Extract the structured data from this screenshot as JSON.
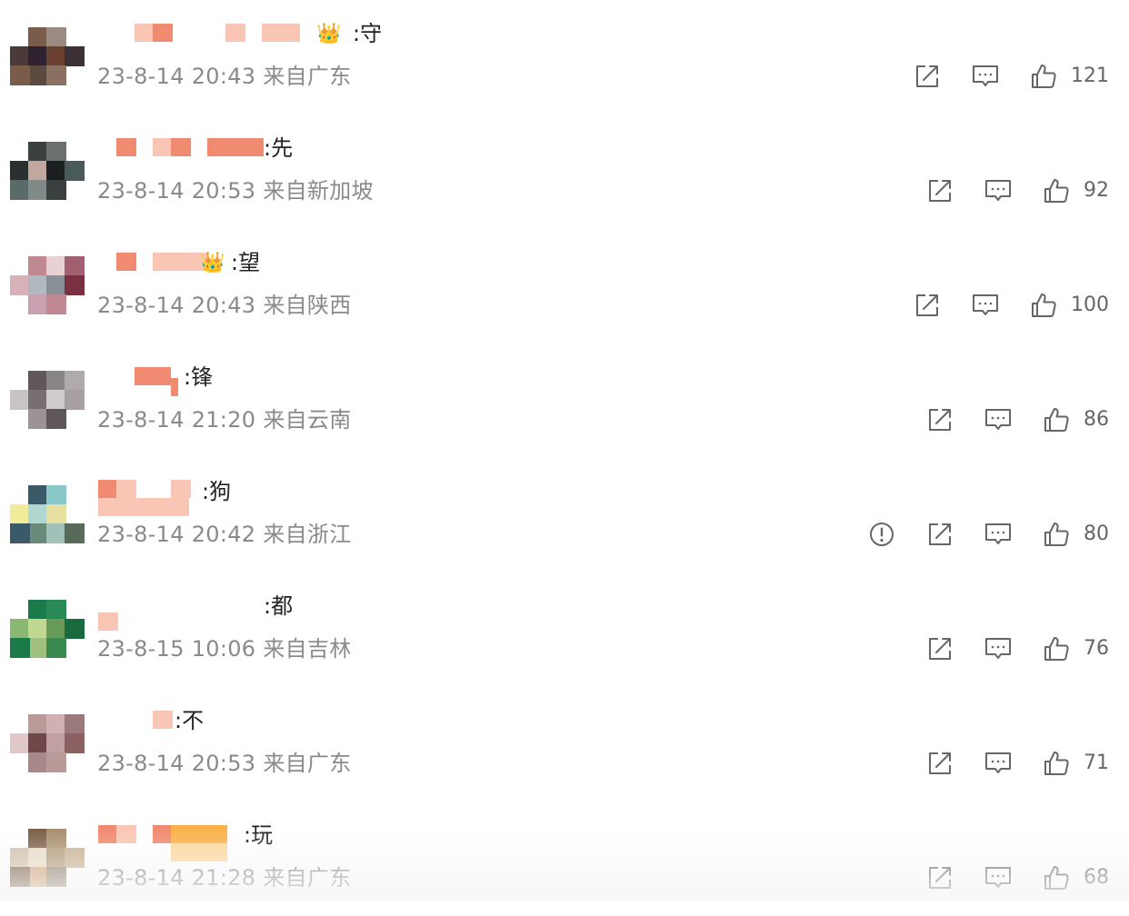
{
  "comments": [
    {
      "text": ":守",
      "timestamp": "23-8-14 20:43",
      "location_prefix": "来自",
      "location": "广东",
      "likes": "121",
      "crown": true,
      "report": false
    },
    {
      "text": ":先",
      "timestamp": "23-8-14 20:53",
      "location_prefix": "来自",
      "location": "新加坡",
      "likes": "92",
      "crown": false,
      "report": false
    },
    {
      "text": ":望",
      "timestamp": "23-8-14 20:43",
      "location_prefix": "来自",
      "location": "陕西",
      "likes": "100",
      "crown": true,
      "report": false
    },
    {
      "text": ":锋",
      "timestamp": "23-8-14 21:20",
      "location_prefix": "来自",
      "location": "云南",
      "likes": "86",
      "crown": false,
      "report": false
    },
    {
      "text": ":狗",
      "timestamp": "23-8-14 20:42",
      "location_prefix": "来自",
      "location": "浙江",
      "likes": "80",
      "crown": false,
      "report": true
    },
    {
      "text": ":都",
      "timestamp": "23-8-15 10:06",
      "location_prefix": "来自",
      "location": "吉林",
      "likes": "76",
      "crown": false,
      "report": false
    },
    {
      "text": ":不",
      "timestamp": "23-8-14 20:53",
      "location_prefix": "来自",
      "location": "广东",
      "likes": "71",
      "crown": false,
      "report": false
    },
    {
      "text": ":玩",
      "timestamp": "23-8-14 21:28",
      "location_prefix": "来自",
      "location": "广东",
      "likes": "68",
      "crown": false,
      "report": false
    }
  ],
  "icons": {
    "report": "exclamation-circle-icon",
    "share": "share-icon",
    "reply": "comment-icon",
    "like": "thumbs-up-icon",
    "crown": "crown-badge-icon"
  },
  "colors": {
    "meta_text": "#8a8a8a",
    "body_text": "#222222",
    "icon": "#666666",
    "mosaic_red": "#f08a70",
    "mosaic_pink": "#f8c4b4",
    "mosaic_orange": "#fbbf5c",
    "crown_gold": "#f0a030"
  }
}
